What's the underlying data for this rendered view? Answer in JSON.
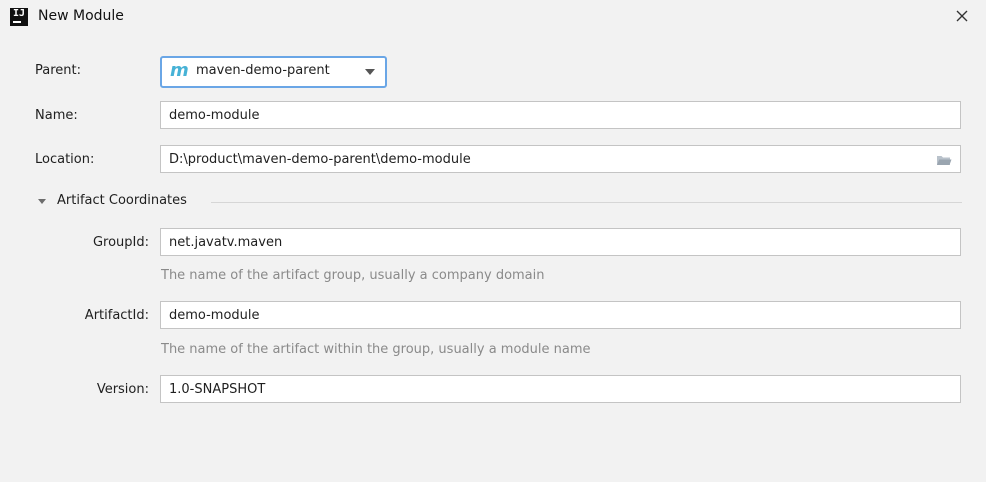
{
  "window": {
    "title": "New Module",
    "app_icon_text": "IJ"
  },
  "form": {
    "parent": {
      "label": "Parent:",
      "value": "maven-demo-parent",
      "icon": "m"
    },
    "name": {
      "label": "Name:",
      "value": "demo-module"
    },
    "location": {
      "label": "Location:",
      "value": "D:\\product\\maven-demo-parent\\demo-module"
    },
    "section": {
      "label": "Artifact Coordinates"
    },
    "group_id": {
      "label": "GroupId:",
      "value": "net.javatv.maven",
      "hint": "The name of the artifact group, usually a company domain"
    },
    "artifact_id": {
      "label": "ArtifactId:",
      "value": "demo-module",
      "hint": "The name of the artifact within the group, usually a module name"
    },
    "version": {
      "label": "Version:",
      "value": "1.0-SNAPSHOT"
    }
  },
  "colors": {
    "background": "#f2f2f2",
    "focus_border": "#6aa6e6",
    "maven_icon": "#47b2d6",
    "hint_text": "#8a8a8a"
  },
  "icons": {
    "close": "close-icon",
    "folder": "folder-icon",
    "maven": "maven-icon",
    "dropdown": "chevron-down-icon",
    "collapse": "triangle-down-icon"
  }
}
